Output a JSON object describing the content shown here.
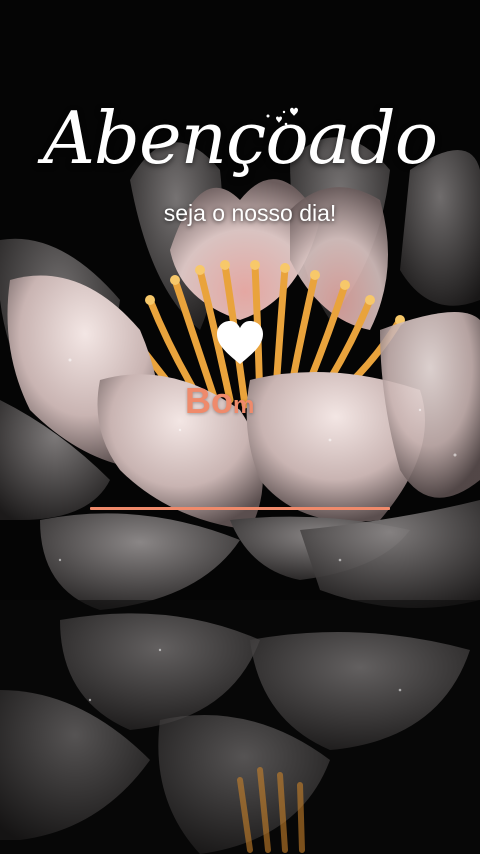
{
  "greeting": {
    "title": "Abençoado",
    "subtitle": "seja o nosso dia!",
    "animated_text_main": "Bo",
    "animated_text_tail": "m"
  },
  "icons": {
    "heart": "heart-icon",
    "sparkle_hearts": "sparkle-hearts-icon"
  },
  "colors": {
    "accent": "#ef8a6b",
    "text": "#ffffff",
    "background": "#050505",
    "petal": "#e8d8d6",
    "stamen": "#f2b453"
  }
}
